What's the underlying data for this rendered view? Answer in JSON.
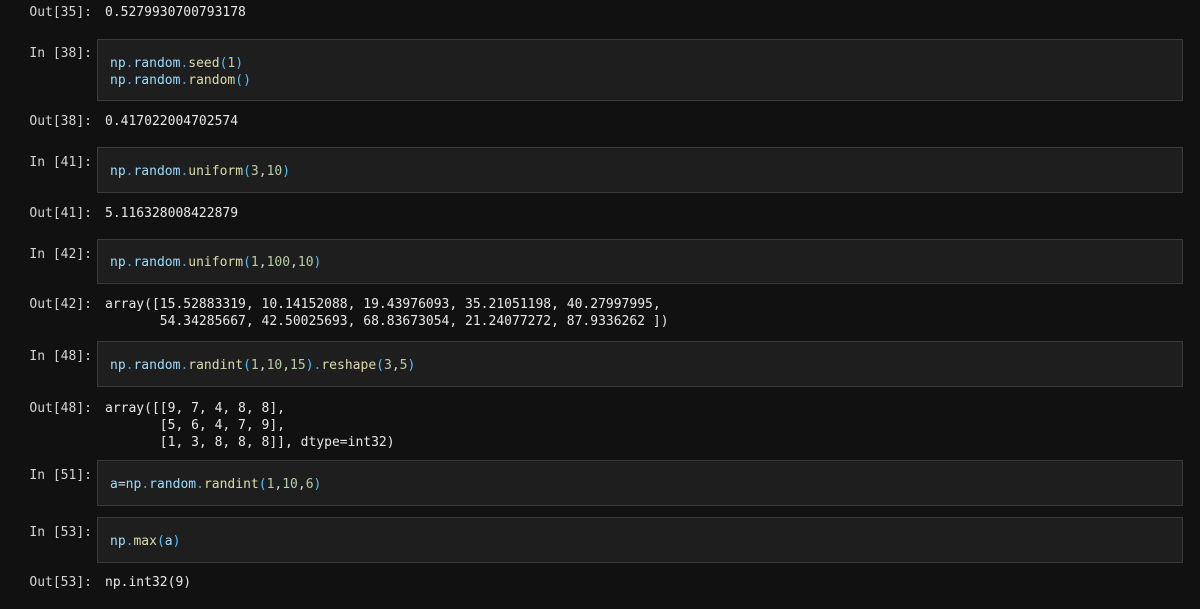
{
  "cells": [
    {
      "kind": "out",
      "prompt": "Out[35]:",
      "text": "0.5279930700793178"
    },
    {
      "kind": "in",
      "prompt": "In [38]:",
      "lines": [
        "np.random.seed(1)",
        "np.random.random()"
      ]
    },
    {
      "kind": "out",
      "prompt": "Out[38]:",
      "text": "0.417022004702574"
    },
    {
      "kind": "in",
      "prompt": "In [41]:",
      "lines": [
        "np.random.uniform(3,10)"
      ]
    },
    {
      "kind": "out",
      "prompt": "Out[41]:",
      "text": "5.116328008422879"
    },
    {
      "kind": "in",
      "prompt": "In [42]:",
      "lines": [
        "np.random.uniform(1,100,10)"
      ]
    },
    {
      "kind": "out",
      "prompt": "Out[42]:",
      "text": "array([15.52883319, 10.14152088, 19.43976093, 35.21051198, 40.27997995,\n       54.34285667, 42.50025693, 68.83673054, 21.24077272, 87.9336262 ])"
    },
    {
      "kind": "in",
      "prompt": "In [48]:",
      "lines": [
        "np.random.randint(1,10,15).reshape(3,5)"
      ]
    },
    {
      "kind": "out",
      "prompt": "Out[48]:",
      "text": "array([[9, 7, 4, 8, 8],\n       [5, 6, 4, 7, 9],\n       [1, 3, 8, 8, 8]], dtype=int32)"
    },
    {
      "kind": "in",
      "prompt": "In [51]:",
      "lines": [
        "a=np.random.randint(1,10,6)"
      ]
    },
    {
      "kind": "in",
      "prompt": "In [53]:",
      "lines": [
        "np.max(a)"
      ]
    },
    {
      "kind": "out",
      "prompt": "Out[53]:",
      "text": "np.int32(9)"
    }
  ],
  "theme": {
    "background": "#111111",
    "cell_background": "#1e1e1e",
    "cell_border": "#3a3a3a"
  }
}
